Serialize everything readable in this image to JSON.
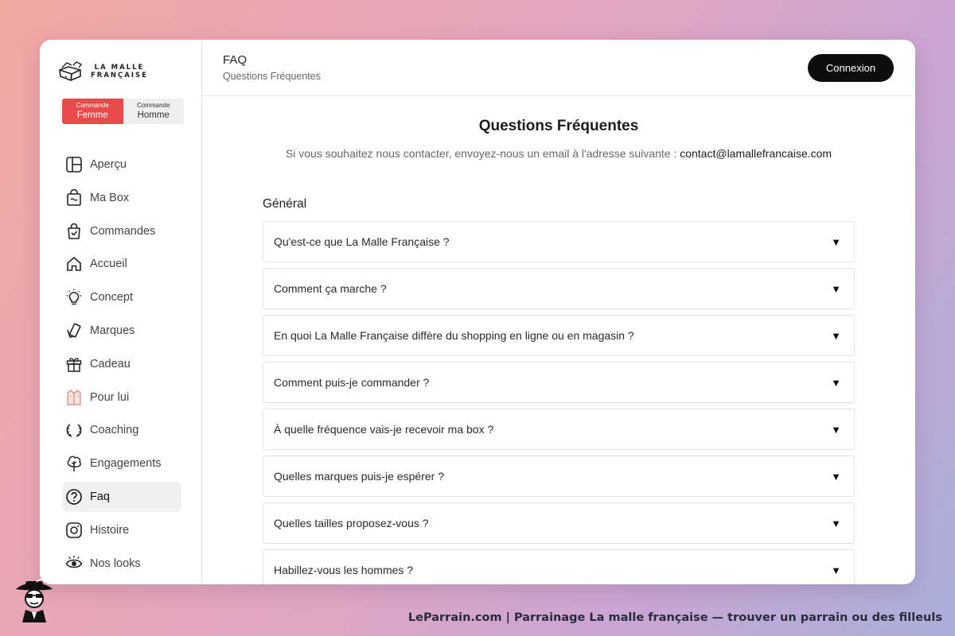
{
  "brand": {
    "line1": "LA MALLE",
    "line2": "FRANÇAISE"
  },
  "gender_toggle": {
    "female": {
      "small": "Commande",
      "big": "Femme"
    },
    "male": {
      "small": "Commande",
      "big": "Homme"
    }
  },
  "nav": [
    {
      "label": "Aperçu",
      "icon": "layout-icon"
    },
    {
      "label": "Ma Box",
      "icon": "shopping-bag-icon"
    },
    {
      "label": "Commandes",
      "icon": "bag-check-icon"
    },
    {
      "label": "Accueil",
      "icon": "home-icon"
    },
    {
      "label": "Concept",
      "icon": "lightbulb-icon"
    },
    {
      "label": "Marques",
      "icon": "tags-icon"
    },
    {
      "label": "Cadeau",
      "icon": "gift-icon"
    },
    {
      "label": "Pour lui",
      "icon": "shirt-icon"
    },
    {
      "label": "Coaching",
      "icon": "laurel-icon"
    },
    {
      "label": "Engagements",
      "icon": "tree-icon"
    },
    {
      "label": "Faq",
      "icon": "question-circle-icon",
      "active": true
    },
    {
      "label": "Histoire",
      "icon": "instagram-icon"
    },
    {
      "label": "Nos looks",
      "icon": "eye-icon"
    }
  ],
  "header": {
    "title": "FAQ",
    "subtitle": "Questions Fréquentes",
    "login_label": "Connexion"
  },
  "faq": {
    "title": "Questions Fréquentes",
    "contact_text": "Si vous souhaitez nous contacter, envoyez-nous un email à l'adresse suivante : ",
    "contact_email": "contact@lamallefrancaise.com",
    "section": "Général",
    "arrow": "▼",
    "questions": [
      "Qu'est-ce que La Malle Française ?",
      "Comment ça marche ?",
      "En quoi La Malle Française diffère du shopping en ligne ou en magasin ?",
      "Comment puis-je commander ?",
      "À quelle fréquence vais-je recevoir ma box ?",
      "Quelles marques puis-je espérer ?",
      "Quelles tailles proposez-vous ?",
      "Habillez-vous les hommes ?"
    ]
  },
  "watermark": {
    "text": "LeParrain.com | Parrainage La malle française — trouver un parrain ou des filleuls"
  },
  "colors": {
    "accent": "#e94b4b",
    "button": "#0d0d0d"
  }
}
